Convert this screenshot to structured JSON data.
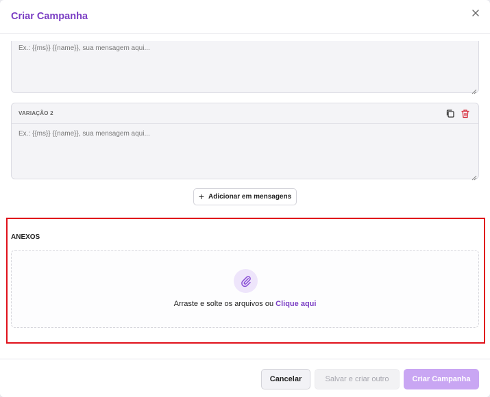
{
  "modal": {
    "title": "Criar Campanha",
    "close_icon": "close-icon"
  },
  "messages": {
    "variation_1": {
      "placeholder": "Ex.: {{ms}} {{name}}, sua mensagem aqui..."
    },
    "variation_2": {
      "label": "VARIAÇÃO 2",
      "placeholder": "Ex.: {{ms}} {{name}}, sua mensagem aqui...",
      "copy_icon": "copy-icon",
      "delete_icon": "trash-icon"
    },
    "add_button_label": "Adicionar em mensagens"
  },
  "attachments": {
    "section_label": "ANEXOS",
    "drop_text": "Arraste e solte os arquivos ou",
    "drop_link": "Clique aqui",
    "icon": "paperclip-icon"
  },
  "footer": {
    "cancel_label": "Cancelar",
    "save_and_new_label": "Salvar e criar outro",
    "create_label": "Criar Campanha"
  },
  "colors": {
    "accent": "#7b3fc4",
    "accent_disabled": "#c9a6f3",
    "danger": "#d62b3a",
    "highlight_border": "#e0101a"
  }
}
